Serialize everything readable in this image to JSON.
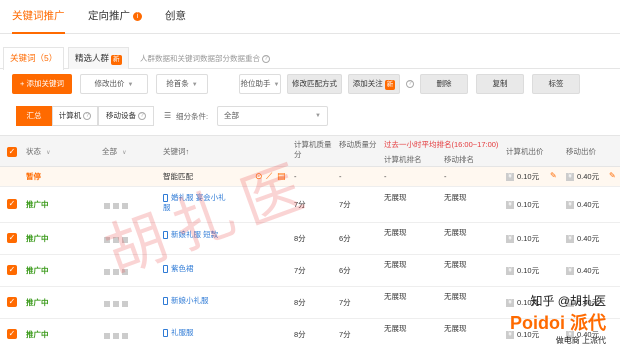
{
  "top_tabs": [
    {
      "label": "关键词推广",
      "active": true
    },
    {
      "label": "定向推广",
      "active": false,
      "info": "i"
    },
    {
      "label": "创意",
      "active": false
    }
  ],
  "sub_tabs": [
    {
      "label": "关键词（5）",
      "active": true
    },
    {
      "label": "精选人群",
      "badge": "新",
      "active": false
    }
  ],
  "sub_note": "人群数据和关键词数据部分数据重合",
  "toolbar": {
    "add_keyword": "+ 添加关键词",
    "modify_bid": "修改出价",
    "rank_bid": "抢首条",
    "rank_helper": "抢位助手",
    "modify_match": "修改匹配方式",
    "add_follow": "添加关注",
    "follow_badge": "新",
    "delete": "删除",
    "copy": "复制",
    "tag": "标签"
  },
  "filters": {
    "segments": [
      "汇总",
      "计算机",
      "移动设备"
    ],
    "condition_label": "细分条件:",
    "condition_value": "全部"
  },
  "columns": {
    "status": "状态",
    "all": "全部",
    "keyword": "关键词↑",
    "pc_quality": "计算机质量分",
    "mobile_quality": "移动质量分",
    "rank_title": "过去一小时平均排名(16:00~17:00)",
    "pc_rank": "计算机排名",
    "mobile_rank": "移动排名",
    "pc_bid": "计算机出价",
    "mobile_bid": "移动出价"
  },
  "rows": [
    {
      "status": "暂停",
      "keyword": "智能匹配",
      "pc_quality": "-",
      "mobile_quality": "-",
      "pc_rank": "-",
      "mobile_rank": "-",
      "pc_bid": "0.10元",
      "mobile_bid": "0.40元"
    },
    {
      "status": "推广中",
      "keyword": "婚礼服 宴会小礼服",
      "pc_quality": "7分",
      "mobile_quality": "7分",
      "pc_rank": "无展现",
      "mobile_rank": "无展现",
      "pc_bid": "0.10元",
      "mobile_bid": "0.40元"
    },
    {
      "status": "推广中",
      "keyword": "新娘礼服 短款",
      "pc_quality": "8分",
      "mobile_quality": "6分",
      "pc_rank": "无展现",
      "mobile_rank": "无展现",
      "pc_bid": "0.10元",
      "mobile_bid": "0.40元"
    },
    {
      "status": "推广中",
      "keyword": "紫色裙",
      "pc_quality": "7分",
      "mobile_quality": "6分",
      "pc_rank": "无展现",
      "mobile_rank": "无展现",
      "pc_bid": "0.10元",
      "mobile_bid": "0.40元"
    },
    {
      "status": "推广中",
      "keyword": "新娘小礼服",
      "pc_quality": "8分",
      "mobile_quality": "7分",
      "pc_rank": "无展现",
      "mobile_rank": "无展现",
      "pc_bid": "0.10元",
      "mobile_bid": "0.40元"
    },
    {
      "status": "推广中",
      "keyword": "礼服服",
      "pc_quality": "8分",
      "mobile_quality": "7分",
      "pc_rank": "无展现",
      "mobile_rank": "无展现",
      "pc_bid": "0.10元",
      "mobile_bid": "0.40元"
    }
  ],
  "watermark": {
    "main": "胡扎医",
    "site": "知乎 @胡扎医",
    "brand": "Poidoi 派代",
    "slogan": "做电商 上派代"
  }
}
